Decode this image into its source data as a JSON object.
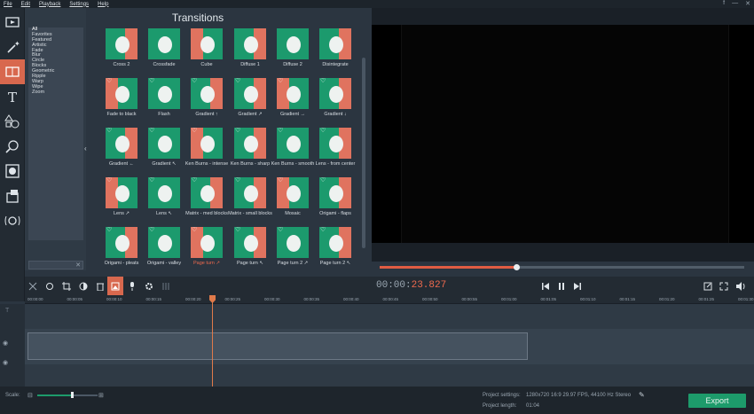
{
  "menu": [
    "File",
    "Edit",
    "Playback",
    "Settings",
    "Help"
  ],
  "panel_title": "Transitions",
  "categories": [
    "All",
    "Favorites",
    "Featured",
    "Artistic",
    "Fade",
    "Blur",
    "Circle",
    "Blocks",
    "Geometric",
    "Ripple",
    "Warp",
    "Wipe",
    "Zoom"
  ],
  "transitions": [
    {
      "label": "Cross 2",
      "fav": false
    },
    {
      "label": "Crossfade",
      "fav": false
    },
    {
      "label": "Cube",
      "fav": false
    },
    {
      "label": "Diffuse 1",
      "fav": false
    },
    {
      "label": "Diffuse 2",
      "fav": false
    },
    {
      "label": "Disintegrate",
      "fav": false
    },
    {
      "label": "Fade to black",
      "fav": true
    },
    {
      "label": "Flash",
      "fav": true
    },
    {
      "label": "Gradient ↑",
      "fav": true
    },
    {
      "label": "Gradient ↗",
      "fav": true
    },
    {
      "label": "Gradient →",
      "fav": true
    },
    {
      "label": "Gradient ↓",
      "fav": true
    },
    {
      "label": "Gradient ←",
      "fav": true
    },
    {
      "label": "Gradient ↖",
      "fav": true
    },
    {
      "label": "Ken Burns - intense",
      "fav": true
    },
    {
      "label": "Ken Burns - sharp",
      "fav": true
    },
    {
      "label": "Ken Burns - smooth",
      "fav": true
    },
    {
      "label": "Lens - from center",
      "fav": true
    },
    {
      "label": "Lens ↗",
      "fav": true
    },
    {
      "label": "Lens ↖",
      "fav": true
    },
    {
      "label": "Matrix - med blocks",
      "fav": true
    },
    {
      "label": "Matrix - small blocks",
      "fav": true
    },
    {
      "label": "Mosaic",
      "fav": true
    },
    {
      "label": "Origami - flaps",
      "fav": true
    },
    {
      "label": "Origami - pleats",
      "fav": true
    },
    {
      "label": "Origami - valley",
      "fav": true
    },
    {
      "label": "Page turn ↗",
      "fav": true,
      "highlight": true
    },
    {
      "label": "Page turn ↖",
      "fav": true
    },
    {
      "label": "Page turn 2 ↗",
      "fav": true
    },
    {
      "label": "Page turn 2 ↖",
      "fav": true
    }
  ],
  "timecode": {
    "dim": "00:00:",
    "bright": "23.827"
  },
  "ruler_ticks": [
    "00:00:00",
    "00:00:05",
    "00:00:10",
    "00:00:15",
    "00:00:20",
    "00:00:25",
    "00:00:30",
    "00:00:35",
    "00:00:40",
    "00:00:45",
    "00:00:50",
    "00:00:55",
    "00:01:00",
    "00:01:05",
    "00:01:10",
    "00:01:15",
    "00:01:20",
    "00:01:25",
    "00:01:30"
  ],
  "status": {
    "scale_label": "Scale:",
    "project_settings_label": "Project settings:",
    "project_settings_value": "1280x720 16:9 29.97 FPS, 44100 Hz Stereo",
    "project_length_label": "Project length:",
    "project_length_value": "01:04",
    "export_label": "Export"
  },
  "playback_progress": 0.375,
  "scale_level": 0.58,
  "colors": {
    "accent": "#d8684e",
    "green": "#1d9b6b",
    "bg": "#2b3540"
  }
}
